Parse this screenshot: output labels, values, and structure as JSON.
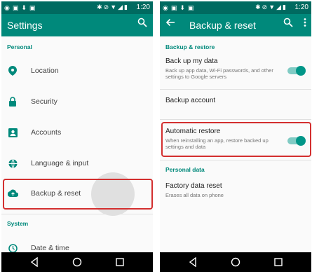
{
  "status": {
    "time": "1:20"
  },
  "left": {
    "title": "Settings",
    "section_personal": "Personal",
    "section_system": "System",
    "items": [
      {
        "label": "Location",
        "icon": "location-pin-icon"
      },
      {
        "label": "Security",
        "icon": "lock-icon"
      },
      {
        "label": "Accounts",
        "icon": "account-box-icon"
      },
      {
        "label": "Language & input",
        "icon": "globe-icon"
      },
      {
        "label": "Backup & reset",
        "icon": "cloud-upload-icon"
      },
      {
        "label": "Date & time",
        "icon": "clock-icon"
      }
    ]
  },
  "right": {
    "title": "Backup & reset",
    "section_backup": "Backup & restore",
    "section_personal": "Personal data",
    "items": [
      {
        "title": "Back up my data",
        "subtitle": "Back up app data, Wi-Fi passwords, and other settings to Google servers",
        "toggle": true
      },
      {
        "title": "Backup account",
        "subtitle": "",
        "toggle": false
      },
      {
        "title": "Automatic restore",
        "subtitle": "When reinstalling an app, restore backed up settings and data",
        "toggle": true
      },
      {
        "title": "Factory data reset",
        "subtitle": "Erases all data on phone",
        "toggle": false
      }
    ]
  },
  "colors": {
    "accent": "#00897b",
    "status_bar": "#006a60",
    "highlight": "#d32f2f"
  }
}
